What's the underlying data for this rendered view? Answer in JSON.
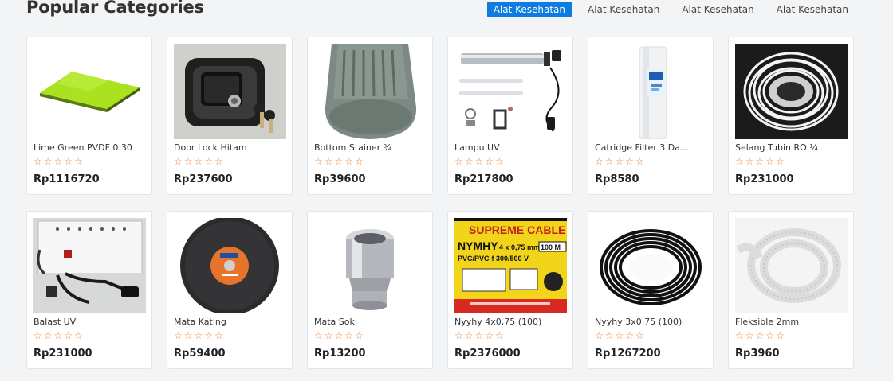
{
  "section": {
    "title": "Popular Categories",
    "tabs": [
      {
        "label": "Alat Kesehatan",
        "active": true
      },
      {
        "label": "Alat Kesehatan",
        "active": false
      },
      {
        "label": "Alat Kesehatan",
        "active": false
      },
      {
        "label": "Alat Kesehatan",
        "active": false
      }
    ]
  },
  "colors": {
    "accent": "#0d7ce0",
    "star": "#e8853d"
  },
  "products": [
    {
      "name": "Lime Green PVDF 0.30",
      "rating": "☆☆☆☆☆",
      "price": "Rp1116720",
      "icon": "lime-panel-image"
    },
    {
      "name": "Door Lock Hitam",
      "rating": "☆☆☆☆☆",
      "price": "Rp237600",
      "icon": "door-lock-image"
    },
    {
      "name": "Bottom Stainer ¾",
      "rating": "☆☆☆☆☆",
      "price": "Rp39600",
      "icon": "strainer-image"
    },
    {
      "name": "Lampu UV",
      "rating": "☆☆☆☆☆",
      "price": "Rp217800",
      "icon": "uv-lamp-image"
    },
    {
      "name": "Catridge Filter 3 Da...",
      "rating": "☆☆☆☆☆",
      "price": "Rp8580",
      "icon": "filter-cartridge-image"
    },
    {
      "name": "Selang Tubin RO ¼",
      "rating": "☆☆☆☆☆",
      "price": "Rp231000",
      "icon": "ro-tubing-image"
    },
    {
      "name": "Balast UV",
      "rating": "☆☆☆☆☆",
      "price": "Rp231000",
      "icon": "ballast-image"
    },
    {
      "name": "Mata Kating",
      "rating": "☆☆☆☆☆",
      "price": "Rp59400",
      "icon": "cutting-disc-image"
    },
    {
      "name": "Mata Sok",
      "rating": "☆☆☆☆☆",
      "price": "Rp13200",
      "icon": "socket-image"
    },
    {
      "name": "Nyyhy 4x0,75 (100)",
      "rating": "☆☆☆☆☆",
      "price": "Rp2376000",
      "icon": "cable-box-image"
    },
    {
      "name": "Nyyhy 3x0,75 (100)",
      "rating": "☆☆☆☆☆",
      "price": "Rp1267200",
      "icon": "black-cable-image"
    },
    {
      "name": "Fleksible 2mm",
      "rating": "☆☆☆☆☆",
      "price": "Rp3960",
      "icon": "flexible-hose-image"
    }
  ],
  "image_text": {
    "cable_brand": "SUPREME CABLE",
    "cable_model": "NYMHY",
    "cable_spec": "4 x 0,75 mm²",
    "cable_length": "100 M",
    "cable_voltage": "PVC/PVC-f 300/500 V"
  }
}
